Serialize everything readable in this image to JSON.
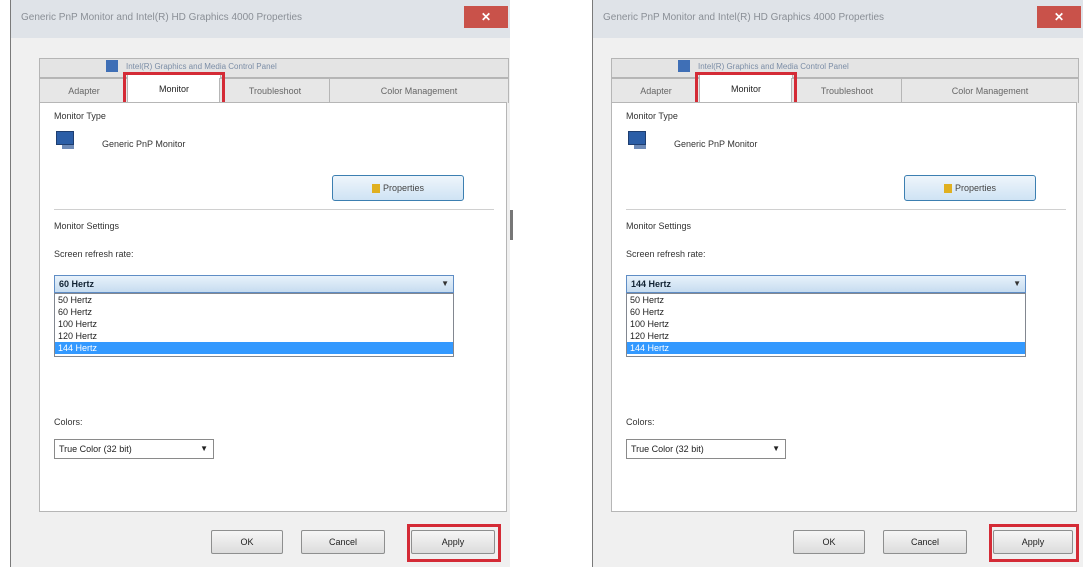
{
  "dialogs": [
    {
      "title": "Generic PnP Monitor and Intel(R) HD Graphics 4000 Properties",
      "close_label": "✕",
      "upper_tab": "Intel(R) Graphics and Media Control Panel",
      "tabs": [
        "Adapter",
        "Monitor",
        "Troubleshoot",
        "Color Management"
      ],
      "monitor_type_label": "Monitor Type",
      "monitor_name": "Generic PnP Monitor",
      "properties_button": "Properties",
      "settings_label": "Monitor Settings",
      "refresh_label": "Screen refresh rate:",
      "refresh_value": "60 Hertz",
      "refresh_options": [
        "50 Hertz",
        "60 Hertz",
        "100 Hertz",
        "120 Hertz",
        "144 Hertz"
      ],
      "refresh_selected_index": 4,
      "colors_label": "Colors:",
      "colors_value": "True Color (32 bit)",
      "buttons": {
        "ok": "OK",
        "cancel": "Cancel",
        "apply": "Apply"
      }
    },
    {
      "title": "Generic PnP Monitor and Intel(R) HD Graphics 4000 Properties",
      "close_label": "✕",
      "upper_tab": "Intel(R) Graphics and Media Control Panel",
      "tabs": [
        "Adapter",
        "Monitor",
        "Troubleshoot",
        "Color Management"
      ],
      "monitor_type_label": "Monitor Type",
      "monitor_name": "Generic PnP Monitor",
      "properties_button": "Properties",
      "settings_label": "Monitor Settings",
      "refresh_label": "Screen refresh rate:",
      "refresh_value": "144 Hertz",
      "refresh_options": [
        "50 Hertz",
        "60 Hertz",
        "100 Hertz",
        "120 Hertz",
        "144 Hertz"
      ],
      "refresh_selected_index": 4,
      "colors_label": "Colors:",
      "colors_value": "True Color (32 bit)",
      "buttons": {
        "ok": "OK",
        "cancel": "Cancel",
        "apply": "Apply"
      }
    }
  ],
  "highlight_color": "#d42b36"
}
